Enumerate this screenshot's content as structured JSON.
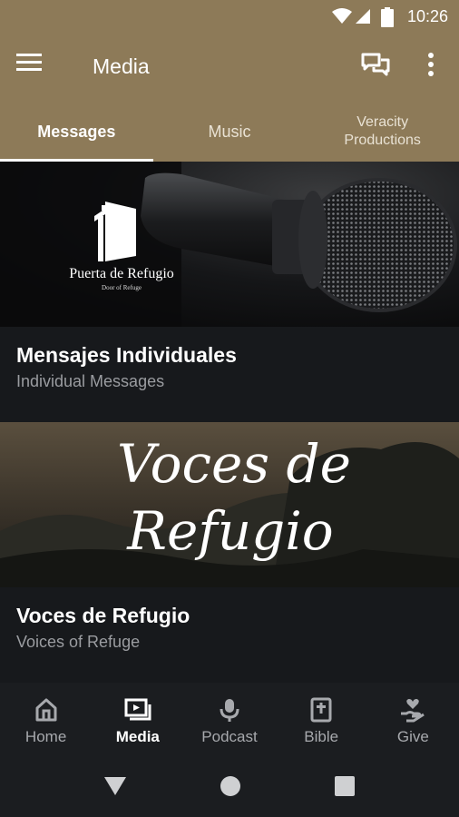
{
  "status_bar": {
    "time": "10:26"
  },
  "app_bar": {
    "title": "Media"
  },
  "tabs": [
    {
      "label": "Messages",
      "active": true
    },
    {
      "label": "Music",
      "active": false
    },
    {
      "label_line1": "Veracity",
      "label_line2": "Productions",
      "active": false
    }
  ],
  "cards": [
    {
      "banner": {
        "logo_name": "Puerta de Refugio",
        "logo_tagline": "Door of Refuge"
      },
      "title": "Mensajes Individuales",
      "subtitle": "Individual Messages"
    },
    {
      "banner": {
        "script_line1": "Voces de",
        "script_line2": "Refugio"
      },
      "title": "Voces de Refugio",
      "subtitle": "Voices of Refuge"
    }
  ],
  "bottom_nav": [
    {
      "label": "Home",
      "icon": "home-icon",
      "active": false
    },
    {
      "label": "Media",
      "icon": "media-icon",
      "active": true
    },
    {
      "label": "Podcast",
      "icon": "microphone-icon",
      "active": false
    },
    {
      "label": "Bible",
      "icon": "bible-icon",
      "active": false
    },
    {
      "label": "Give",
      "icon": "give-icon",
      "active": false
    }
  ],
  "colors": {
    "brand": "#8d7a58",
    "background": "#17191c",
    "nav": "#1b1d20"
  }
}
